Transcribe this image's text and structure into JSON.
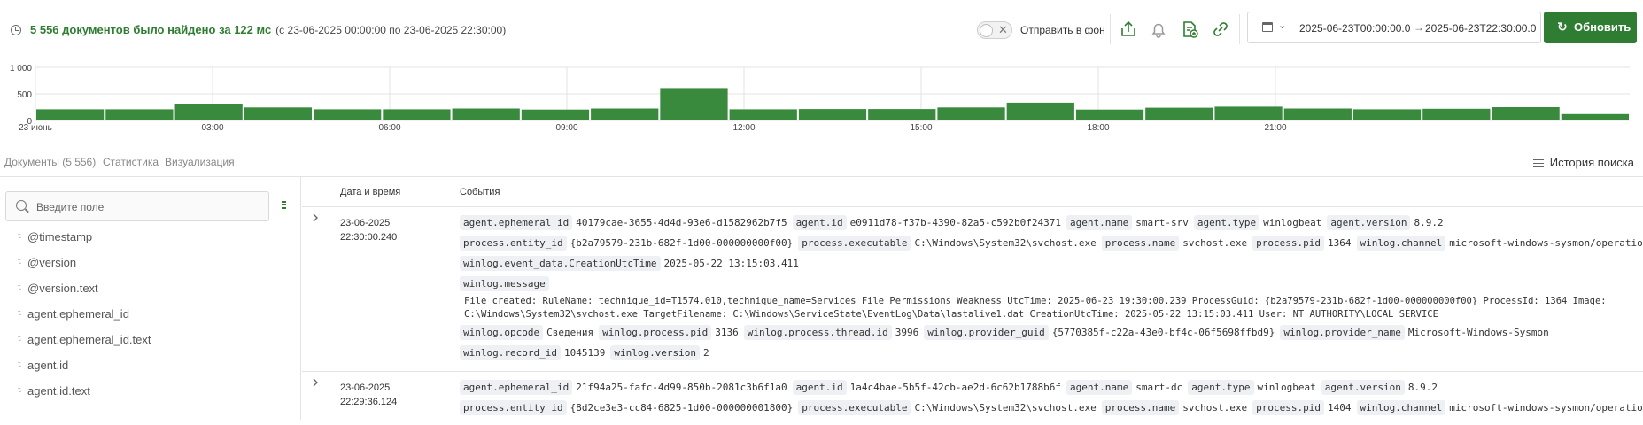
{
  "header": {
    "found_text": "5 556 документов было найдено за 122 мс",
    "range_text": "(с 23-06-2025 00:00:00 по 23-06-2025 22:30:00)",
    "send_bg_label": "Отправить в фон",
    "date_from": "2025-06-23T00:00:00.0",
    "date_arrow": "→",
    "date_to": "2025-06-23T22:30:00.0",
    "refresh_label": "Обновить",
    "toggle_x": "✕",
    "refresh_icon": "↻",
    "calendar_chevron": "⌄"
  },
  "chart_data": {
    "type": "bar",
    "y_ticks": [
      "1 000",
      "500",
      "0"
    ],
    "ylim": [
      0,
      1000
    ],
    "x_ticks": [
      "23 июнь",
      "03:00",
      "06:00",
      "09:00",
      "12:00",
      "15:00",
      "18:00",
      "21:00"
    ],
    "x_tick_slots": [
      0,
      3,
      6,
      9,
      12,
      15,
      18,
      21
    ],
    "bar_color": "#3a8a3e",
    "values": [
      210,
      210,
      310,
      245,
      210,
      210,
      225,
      205,
      225,
      610,
      210,
      215,
      215,
      245,
      335,
      205,
      240,
      260,
      225,
      210,
      220,
      250,
      120
    ],
    "grid": true
  },
  "tabs": [
    {
      "label": "Документы (5 556)"
    },
    {
      "label": "Статистика"
    },
    {
      "label": "Визуализация"
    }
  ],
  "history_label": "История поиска",
  "sidebar": {
    "search_placeholder": "Введите поле",
    "field_type": "t",
    "fields": [
      "@timestamp",
      "@version",
      "@version.text",
      "agent.ephemeral_id",
      "agent.ephemeral_id.text",
      "agent.id",
      "agent.id.text"
    ]
  },
  "table": {
    "col_date": "Дата и время",
    "col_events": "События",
    "rows": [
      {
        "date": "23-06-2025",
        "time": "22:30:00.240",
        "line1": [
          [
            "agent.ephemeral_id",
            "40179cae-3655-4d4d-93e6-d1582962b7f5"
          ],
          [
            "agent.id",
            "e0911d78-f37b-4390-82a5-c592b0f24371"
          ],
          [
            "agent.name",
            "smart-srv"
          ],
          [
            "agent.type",
            "winlogbeat"
          ],
          [
            "agent.version",
            "8.9.2"
          ]
        ],
        "line2": [
          [
            "process.entity_id",
            "{b2a79579-231b-682f-1d00-000000000f00}"
          ],
          [
            "process.executable",
            "C:\\Windows\\System32\\svchost.exe"
          ],
          [
            "process.name",
            "svchost.exe"
          ],
          [
            "process.pid",
            "1364"
          ],
          [
            "winlog.channel",
            "microsoft-windows-sysmon/operational"
          ]
        ],
        "line3": [
          [
            "winlog.event_data.CreationUtcTime",
            "2025-05-22 13:15:03.411"
          ]
        ],
        "message_key": "winlog.message",
        "message_1": "File created: RuleName: technique_id=T1574.010,technique_name=Services File Permissions Weakness UtcTime: 2025-06-23 19:30:00.239 ProcessGuid: {b2a79579-231b-682f-1d00-000000000f00} ProcessId: 1364 Image:",
        "message_2": "C:\\Windows\\System32\\svchost.exe TargetFilename: C:\\Windows\\ServiceState\\EventLog\\Data\\lastalive1.dat CreationUtcTime: 2025-05-22 13:15:03.411 User: NT AUTHORITY\\LOCAL SERVICE",
        "line4": [
          [
            "winlog.opcode",
            "Сведения"
          ],
          [
            "winlog.process.pid",
            "3136"
          ],
          [
            "winlog.process.thread.id",
            "3996"
          ],
          [
            "winlog.provider_guid",
            "{5770385f-c22a-43e0-bf4c-06f5698ffbd9}"
          ],
          [
            "winlog.provider_name",
            "Microsoft-Windows-Sysmon"
          ]
        ],
        "line5": [
          [
            "winlog.record_id",
            "1045139"
          ],
          [
            "winlog.version",
            "2"
          ]
        ]
      },
      {
        "date": "23-06-2025",
        "time": "22:29:36.124",
        "line1": [
          [
            "agent.ephemeral_id",
            "21f94a25-fafc-4d99-850b-2081c3b6f1a0"
          ],
          [
            "agent.id",
            "1a4c4bae-5b5f-42cb-ae2d-6c62b1788b6f"
          ],
          [
            "agent.name",
            "smart-dc"
          ],
          [
            "agent.type",
            "winlogbeat"
          ],
          [
            "agent.version",
            "8.9.2"
          ]
        ],
        "line2": [
          [
            "process.entity_id",
            "{8d2ce3e3-cc84-6825-1d00-000000001800}"
          ],
          [
            "process.executable",
            "C:\\Windows\\System32\\svchost.exe"
          ],
          [
            "process.name",
            "svchost.exe"
          ],
          [
            "process.pid",
            "1404"
          ],
          [
            "winlog.channel",
            "microsoft-windows-sysmon/operational"
          ]
        ]
      }
    ]
  }
}
